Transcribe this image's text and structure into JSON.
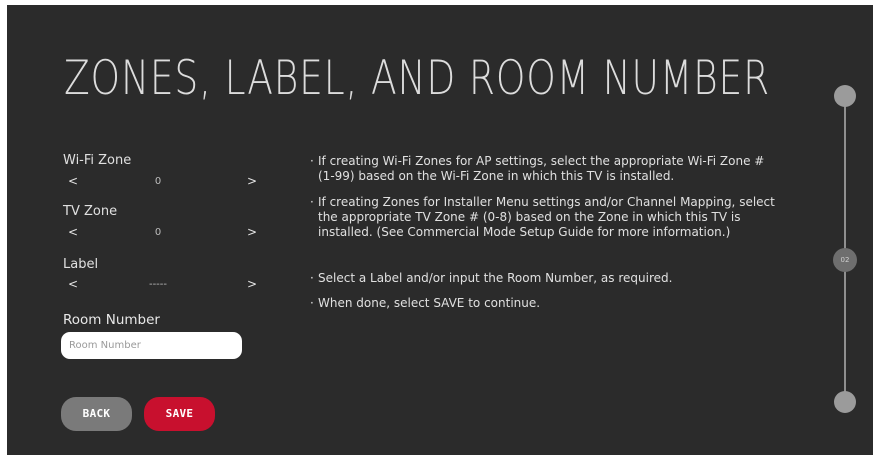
{
  "page": {
    "title": "ZONES, LABEL, AND ROOM NUMBER"
  },
  "form": {
    "wifi_zone": {
      "label": "Wi-Fi Zone",
      "value": "0",
      "prev": "<",
      "next": ">"
    },
    "tv_zone": {
      "label": "TV Zone",
      "value": "0",
      "prev": "<",
      "next": ">"
    },
    "label_field": {
      "label": "Label",
      "value": "-----",
      "prev": "<",
      "next": ">"
    },
    "room_number": {
      "label": "Room Number",
      "placeholder": "Room Number"
    },
    "buttons": {
      "back": "BACK",
      "save": "SAVE"
    }
  },
  "instructions": [
    "If creating Wi-Fi Zones for AP settings, select the appropriate Wi-Fi Zone # (1-99) based on the Wi-Fi Zone in which this TV is installed.",
    "If creating Zones for Installer Menu settings and/or Channel Mapping, select the appropriate TV Zone # (0-8) based on the Zone in which this TV is installed. (See Commercial Mode Setup Guide for more information.)",
    "Select a Label and/or input the Room Number, as required.",
    "When done, select SAVE to continue."
  ],
  "bullet_char": "·",
  "progress": {
    "step_label": "02"
  },
  "colors": {
    "background": "#2b2b2b",
    "accent": "#c8102e",
    "back_button": "#7a7a7a"
  }
}
